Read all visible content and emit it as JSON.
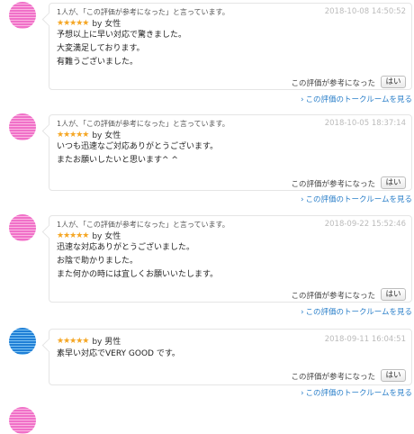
{
  "reviews": [
    {
      "avatar": "female",
      "helpful_count": "1人が、「この評価が参考になった」と言っています。",
      "date": "2018-10-08 14:50:52",
      "stars": "★★★★★",
      "gender": "by 女性",
      "lines": [
        "予想以上に早い対応で驚きました。",
        "大変満足しております。",
        "有難うございました。"
      ],
      "helpful_question": "この評価が参考になった",
      "yes_label": "はい",
      "talk_link": "この評価のトークルームを見る"
    },
    {
      "avatar": "female",
      "helpful_count": "1人が、「この評価が参考になった」と言っています。",
      "date": "2018-10-05 18:37:14",
      "stars": "★★★★★",
      "gender": "by 女性",
      "lines": [
        "いつも迅速なご対応ありがとうございます。",
        "またお願いしたいと思います^ ^"
      ],
      "helpful_question": "この評価が参考になった",
      "yes_label": "はい",
      "talk_link": "この評価のトークルームを見る"
    },
    {
      "avatar": "female",
      "helpful_count": "1人が、「この評価が参考になった」と言っています。",
      "date": "2018-09-22 15:52:46",
      "stars": "★★★★★",
      "gender": "by 女性",
      "lines": [
        "迅速な対応ありがとうございました。",
        "お陰で助かりました。",
        "また何かの時には宜しくお願いいたします。"
      ],
      "helpful_question": "この評価が参考になった",
      "yes_label": "はい",
      "talk_link": "この評価のトークルームを見る"
    },
    {
      "avatar": "male",
      "helpful_count": "",
      "date": "2018-09-11 16:04:51",
      "stars": "★★★★★",
      "gender": "by 男性",
      "lines": [
        "素早い対応でVERY GOOD です。"
      ],
      "helpful_question": "この評価が参考になった",
      "yes_label": "はい",
      "talk_link": "この評価のトークルームを見る"
    }
  ],
  "icons": {
    "chevron": "chevron-right-icon",
    "star": "star-icon"
  },
  "colors": {
    "link": "#2a7fc9",
    "star": "#f5a623",
    "female_avatar": "#f070c8",
    "male_avatar": "#1f7fd6"
  }
}
